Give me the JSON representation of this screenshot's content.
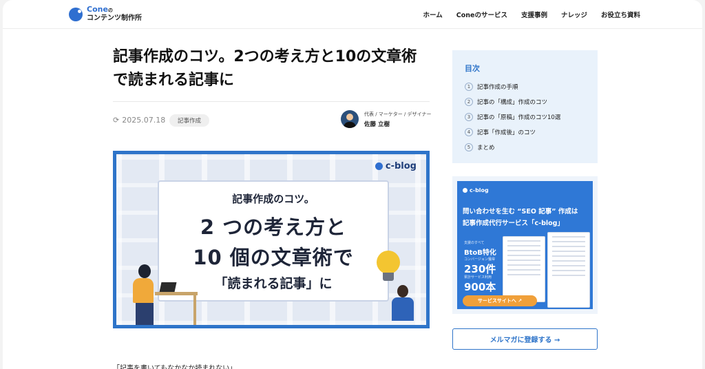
{
  "header": {
    "logo_brand": "Cone",
    "logo_suffix": "の",
    "logo_sub": "コンテンツ制作所",
    "nav": [
      "ホーム",
      "Coneのサービス",
      "支援事例",
      "ナレッジ",
      "お役立ち資料"
    ]
  },
  "article": {
    "title": "記事作成のコツ。2つの考え方と10の文章術で読まれる記事に",
    "date": "2025.07.18",
    "tag": "記事作成",
    "author_role": "代表 / マーケター / デザイナー",
    "author_name": "佐藤 立樹",
    "body_first_line": "「記事を書いてもなかなか読まれない」"
  },
  "hero": {
    "brand": "c-blog",
    "line1": "記事作成のコツ。",
    "line2": "2 つの考え方と",
    "line3": "10 個の文章術で",
    "line4": "「読まれる記事」に"
  },
  "toc": {
    "title": "目次",
    "items": [
      {
        "num": "1",
        "label": "記事作成の手順"
      },
      {
        "num": "2",
        "label": "記事の「構成」作成のコツ"
      },
      {
        "num": "3",
        "label": "記事の「原稿」作成のコツ10選"
      },
      {
        "num": "4",
        "label": "記事「作成後」のコツ"
      },
      {
        "num": "5",
        "label": "まとめ"
      }
    ]
  },
  "ad": {
    "brand": "c-blog",
    "headline1": "問い合わせを生む “SEO 記事” 作成は",
    "headline2": "記事作成代行サービス「c-blog」",
    "stats": [
      {
        "caption": "支援のすべて",
        "value": "BtoB特化"
      },
      {
        "caption": "コンバージョン獲得",
        "value": "230件"
      },
      {
        "caption": "累計サービス利用",
        "value": "900本"
      }
    ],
    "button": "サービスサイトへ ↗"
  },
  "newsletter_button": "メルマガに登録する →",
  "colors": {
    "accent": "#2e74c9",
    "toc_bg": "#e9f2fb",
    "cta_orange": "#f0a03a"
  }
}
